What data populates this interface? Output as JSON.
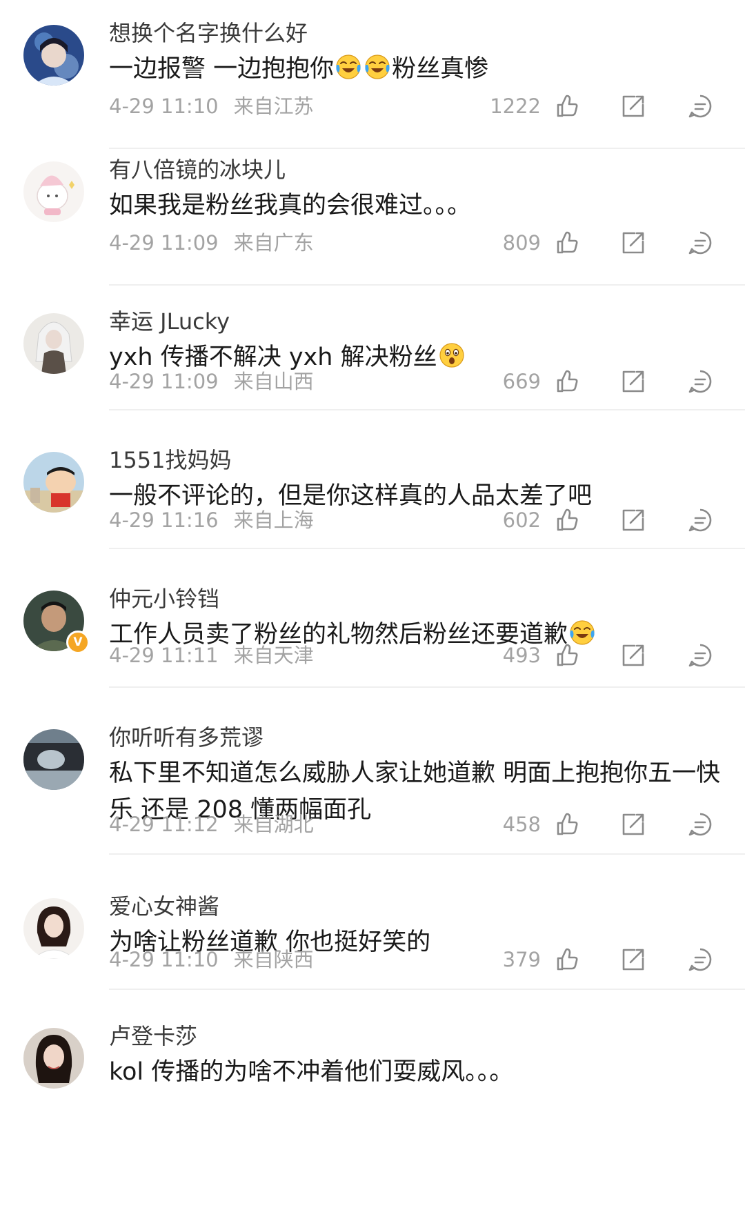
{
  "comments": [
    {
      "username": "想换个名字换什么好",
      "text_parts": [
        "一边报警 一边抱抱你",
        "",
        "粉丝真惨"
      ],
      "emojis": [
        "crying-laughing-emoji",
        "crying-laughing-emoji"
      ],
      "time": "4-29 11:10",
      "location": "来自江苏",
      "likes": "1222"
    },
    {
      "username": "有八倍镜的冰块儿",
      "text": "如果我是粉丝我真的会很难过。。。",
      "time": "4-29 11:09",
      "location": "来自广东",
      "likes": "809"
    },
    {
      "username": "幸运 JLucky",
      "text": "yxh 传播不解决 yxh 解决粉丝",
      "emojis": [
        "astonished-emoji"
      ],
      "time": "4-29 11:09",
      "location": "来自山西",
      "likes": "669"
    },
    {
      "username": "1551找妈妈",
      "text": "一般不评论的，但是你这样真的人品太差了吧",
      "time": "4-29 11:16",
      "location": "来自上海",
      "likes": "602"
    },
    {
      "username": "仲元小铃铛",
      "text": "工作人员卖了粉丝的礼物然后粉丝还要道歉",
      "emojis": [
        "crying-laughing-emoji"
      ],
      "badge": "V",
      "time": "4-29 11:11",
      "location": "来自天津",
      "likes": "493"
    },
    {
      "username": "你听听有多荒谬",
      "text": "私下里不知道怎么威胁人家让她道歉 明面上抱抱你五一快乐 还是 208 懂两幅面孔",
      "time": "4-29 11:12",
      "location": "来自湖北",
      "likes": "458"
    },
    {
      "username": "爱心女神酱",
      "text": "为啥让粉丝道歉 你也挺好笑的",
      "time": "4-29 11:10",
      "location": "来自陕西",
      "likes": "379"
    },
    {
      "username": "卢登卡莎",
      "text": "kol 传播的为啥不冲着他们耍威风。。。"
    }
  ],
  "icons": {
    "like": "thumbs-up-icon",
    "share": "share-icon",
    "reply": "comment-icon"
  },
  "colors": {
    "text": "#1a1a1a",
    "username": "#3a3a3a",
    "meta": "#a3a3a3",
    "icon": "#8a8a8a",
    "divider": "#efefef",
    "verified_badge": "#f5a623"
  }
}
